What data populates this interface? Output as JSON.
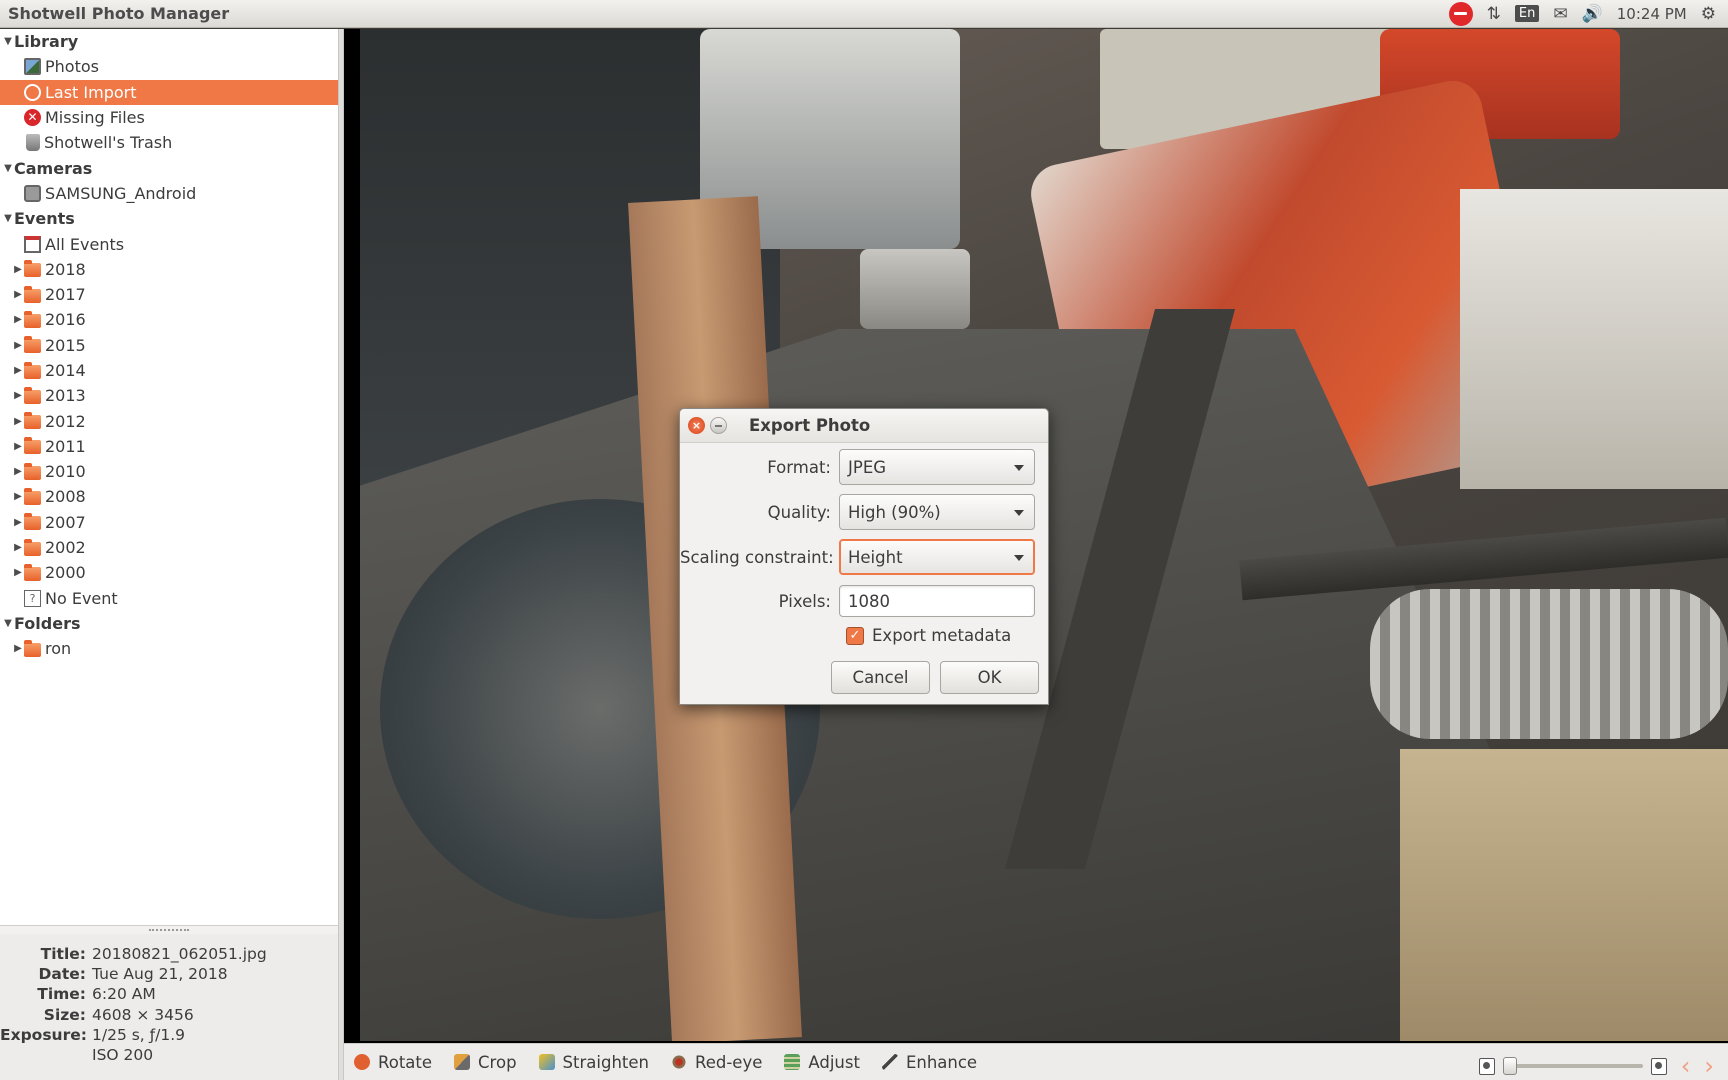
{
  "app": {
    "title": "Shotwell Photo Manager"
  },
  "panel": {
    "clock": "10:24 PM",
    "language": "En"
  },
  "sidebar": {
    "library_header": "Library",
    "library_items": [
      "Photos",
      "Last Import",
      "Missing Files",
      "Shotwell's Trash"
    ],
    "selected_item": "Last Import",
    "cameras_header": "Cameras",
    "camera_items": [
      "SAMSUNG_Android"
    ],
    "events_header": "Events",
    "all_events": "All Events",
    "years": [
      "2018",
      "2017",
      "2016",
      "2015",
      "2014",
      "2013",
      "2012",
      "2011",
      "2010",
      "2008",
      "2007",
      "2002",
      "2000"
    ],
    "no_event": "No Event",
    "folders_header": "Folders",
    "folder_items": [
      "ron"
    ]
  },
  "info": {
    "title_label": "Title:",
    "title_value": "20180821_062051.jpg",
    "date_label": "Date:",
    "date_value": "Tue Aug 21, 2018",
    "time_label": "Time:",
    "time_value": "6:20 AM",
    "size_label": "Size:",
    "size_value": "4608 × 3456",
    "exposure_label": "Exposure:",
    "exposure_value": "1/25 s, ƒ/1.9",
    "iso_value": "ISO 200"
  },
  "toolbar": {
    "rotate": "Rotate",
    "crop": "Crop",
    "straighten": "Straighten",
    "redeye": "Red-eye",
    "adjust": "Adjust",
    "enhance": "Enhance"
  },
  "zoom": {
    "level": 0.0
  },
  "dialog": {
    "title": "Export Photo",
    "format_label": "Format:",
    "format_value": "JPEG",
    "quality_label": "Quality:",
    "quality_value": "High (90%)",
    "scaling_label": "Scaling constraint:",
    "scaling_value": "Height",
    "pixels_label": "Pixels:",
    "pixels_value": "1080",
    "export_metadata_label": "Export metadata",
    "export_metadata_checked": true,
    "cancel_label": "Cancel",
    "ok_label": "OK"
  },
  "colors": {
    "accent": "#f07746",
    "panel": "#dcdad5",
    "sidebar_bg": "#ffffff"
  }
}
